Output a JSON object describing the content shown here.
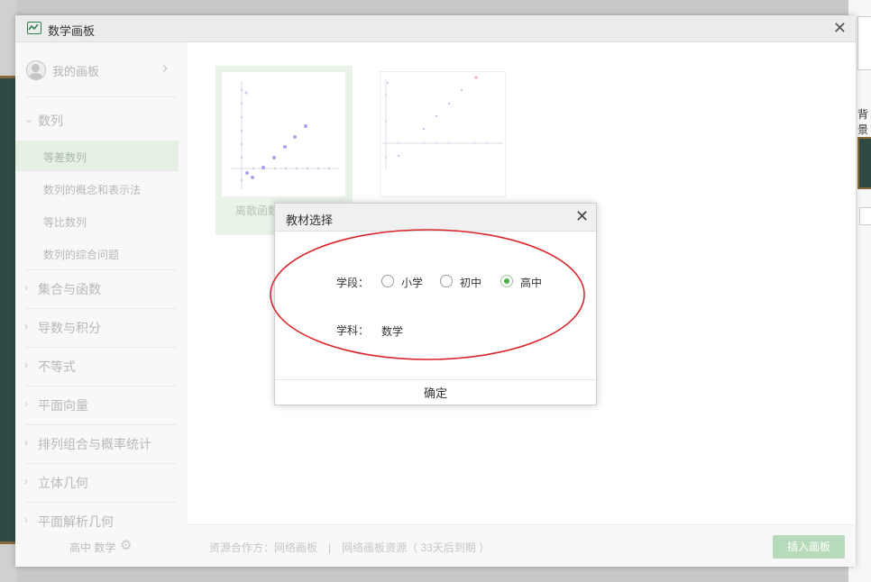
{
  "window": {
    "title": "数学画板",
    "close_glyph": "✕"
  },
  "sidebar": {
    "my_board": "我的画板",
    "categories": [
      {
        "label": "数列",
        "subitems": [
          "等差数列",
          "数列的概念和表示法",
          "等比数列",
          "数列的综合问题"
        ],
        "active_sub": "等差数列"
      },
      {
        "label": "集合与函数"
      },
      {
        "label": "导数与积分"
      },
      {
        "label": "不等式"
      },
      {
        "label": "平面向量"
      },
      {
        "label": "排列组合与概率统计"
      },
      {
        "label": "立体几何"
      },
      {
        "label": "平面解析几何"
      }
    ],
    "footer_text": "高中 数学"
  },
  "main": {
    "thumb1_caption": "离散函数",
    "footer_info": "资源合作方：网络画板　|　网络画板资源（ 33天后到期 ）",
    "insert_button": "插入画板"
  },
  "dialog": {
    "title": "教材选择",
    "stage_label": "学段：",
    "stage_options": [
      "小学",
      "初中",
      "高中"
    ],
    "stage_selected": "高中",
    "subject_label": "学科：",
    "subject_value": "数学",
    "confirm": "确定"
  },
  "background": {
    "side_text": "背景"
  },
  "colors": {
    "accent": "#4caf50",
    "annotation": "#d9262c",
    "active_bg": "#e7f0e5",
    "insert_btn": "#b7dbba"
  },
  "icons": [
    "app-logo-icon",
    "close-icon",
    "avatar-icon",
    "chevron-right-icon",
    "gear-icon"
  ]
}
